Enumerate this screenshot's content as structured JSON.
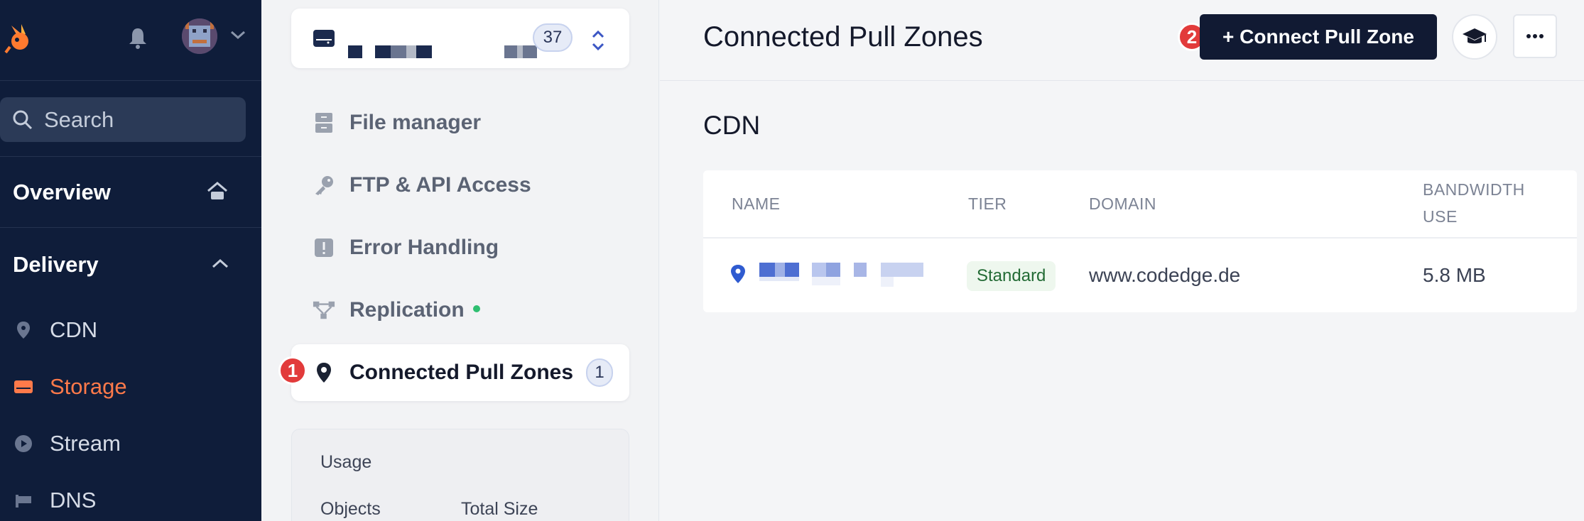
{
  "nav": {
    "search_placeholder": "Search",
    "overview_label": "Overview",
    "delivery_label": "Delivery",
    "items": [
      {
        "label": "CDN",
        "icon": "map-pin-icon"
      },
      {
        "label": "Storage",
        "icon": "storage-icon",
        "active": true
      },
      {
        "label": "Stream",
        "icon": "play-icon"
      },
      {
        "label": "DNS",
        "icon": "dns-icon"
      }
    ]
  },
  "storage_zone": {
    "file_count": "37"
  },
  "submenu": {
    "items": [
      {
        "label": "File manager",
        "icon": "file-cabinet-icon"
      },
      {
        "label": "FTP & API Access",
        "icon": "key-icon"
      },
      {
        "label": "Error Handling",
        "icon": "alert-icon"
      },
      {
        "label": "Replication",
        "icon": "replication-icon"
      },
      {
        "label": "Connected Pull Zones",
        "icon": "map-pin-icon",
        "count": "1",
        "active": true
      }
    ]
  },
  "usage": {
    "title": "Usage",
    "col_objects": "Objects",
    "col_total_size": "Total Size"
  },
  "step_badges": [
    "1",
    "2"
  ],
  "main": {
    "title": "Connected Pull Zones",
    "connect_button": "+ Connect Pull Zone",
    "section_title": "CDN",
    "table": {
      "headers": [
        "NAME",
        "TIER",
        "DOMAIN",
        "BANDWIDTH",
        "USE"
      ],
      "rows": [
        {
          "tier": "Standard",
          "domain": "www.codedge.de",
          "bandwidth": "5.8 MB"
        }
      ]
    }
  },
  "colors": {
    "nav_bg": "#0f1d3a",
    "accent_orange": "#ff7a4a",
    "primary_button": "#111a33",
    "step_badge_red": "#e23b3b",
    "status_green": "#2fbf71"
  }
}
